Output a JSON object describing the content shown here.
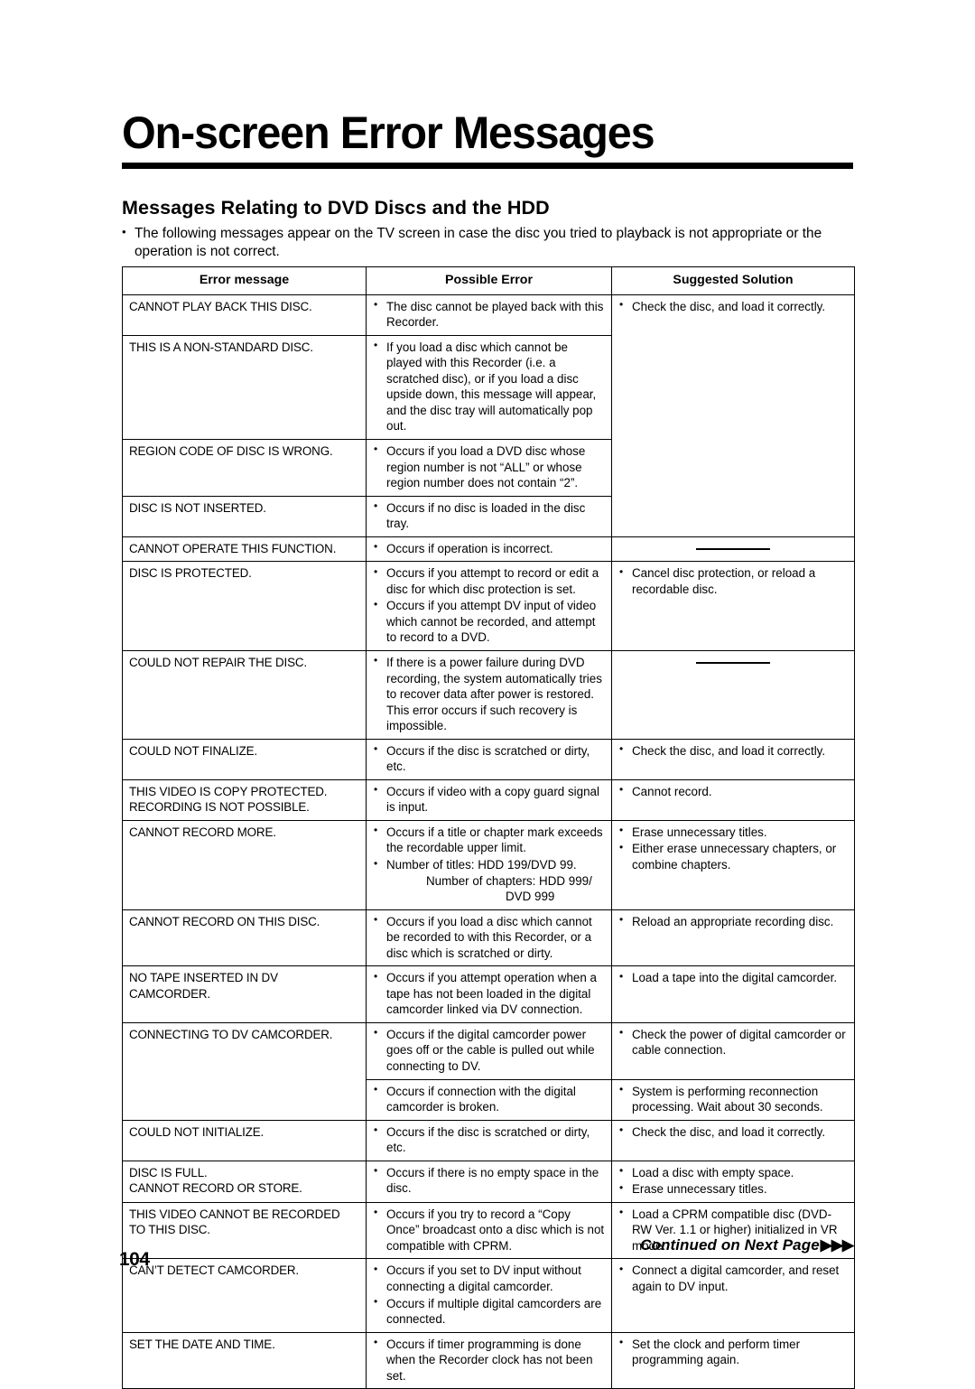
{
  "document": {
    "title": "On-screen Error Messages",
    "section_heading": "Messages Relating to DVD Discs and the HDD",
    "intro": "The following messages appear on the TV screen in case the disc you tried to playback is not appropriate or the operation is not correct.",
    "page_number": "104",
    "continued_label": "Continued on Next Page",
    "continued_arrows": "▶▶▶"
  },
  "table": {
    "headers": {
      "error_message": "Error message",
      "possible_error": "Possible Error",
      "suggested_solution": "Suggested Solution"
    },
    "rows": {
      "r1": {
        "message": "CANNOT PLAY BACK THIS DISC.",
        "error_1": "The disc cannot be played back with this Recorder.",
        "solution_1": "Check the disc, and load it correctly."
      },
      "r2": {
        "message": "THIS IS A NON-STANDARD DISC.",
        "error_1": "If you load a disc which cannot be played with this Recorder (i.e. a scratched disc), or if you load a disc upside down, this message will appear, and the disc tray will automatically pop out."
      },
      "r3": {
        "message": "REGION CODE OF DISC IS WRONG.",
        "error_1": "Occurs if you load a DVD disc whose region number is not “ALL” or whose region number does not contain “2”."
      },
      "r4": {
        "message": "DISC IS NOT INSERTED.",
        "error_1": "Occurs if no disc is loaded in the disc tray."
      },
      "r5": {
        "message": "CANNOT OPERATE THIS FUNCTION.",
        "error_1": "Occurs if operation is incorrect.",
        "solution_1": "—"
      },
      "r6": {
        "message": "DISC IS PROTECTED.",
        "error_1": "Occurs if you attempt to record or edit a disc for which disc protection is set.",
        "error_2": "Occurs if you attempt DV input of video which cannot be recorded, and attempt to record to a DVD.",
        "solution_1": "Cancel disc protection, or reload a recordable disc."
      },
      "r7": {
        "message": "COULD NOT REPAIR THE DISC.",
        "error_1": "If there is a power failure during DVD recording, the system automatically tries to recover data after power is restored. This error occurs if such recovery is impossible.",
        "solution_1": "—"
      },
      "r8": {
        "message": "COULD NOT FINALIZE.",
        "error_1": "Occurs if the disc is scratched or dirty, etc.",
        "solution_1": "Check the disc, and load it correctly."
      },
      "r9": {
        "message_line1": "THIS VIDEO IS COPY PROTECTED.",
        "message_line2": "RECORDING IS NOT POSSIBLE.",
        "error_1": "Occurs if video with a copy guard signal is input.",
        "solution_1": "Cannot record."
      },
      "r10": {
        "message": "CANNOT RECORD MORE.",
        "error_1": "Occurs if a title or chapter mark exceeds the recordable upper limit.",
        "error_2": "Number of titles: HDD 199/DVD 99.",
        "error_2_cont": "Number of chapters:  HDD 999/",
        "error_2_cont2": "DVD 999",
        "solution_1": "Erase unnecessary titles.",
        "solution_2": "Either erase unnecessary chapters, or combine chapters."
      },
      "r11": {
        "message": "CANNOT RECORD ON THIS DISC.",
        "error_1": "Occurs if you load a disc which cannot be recorded to with this Recorder, or a disc which is scratched or dirty.",
        "solution_1": "Reload an appropriate recording disc."
      },
      "r12": {
        "message_line1": "NO TAPE INSERTED IN DV",
        "message_line2": "CAMCORDER.",
        "error_1": "Occurs if you attempt operation when a tape has not been loaded in the digital camcorder linked via DV connection.",
        "solution_1": "Load a tape into the digital camcorder."
      },
      "r13": {
        "message": "CONNECTING TO DV CAMCORDER.",
        "error_1": "Occurs if the digital camcorder power goes off or the cable is pulled out while connecting to DV.",
        "solution_1": "Check the power of digital camcorder or cable connection.",
        "error_2": "Occurs if connection with the digital camcorder is broken.",
        "solution_2": "System is performing reconnection processing. Wait about 30 seconds."
      },
      "r14": {
        "message": "COULD NOT INITIALIZE.",
        "error_1": "Occurs if the disc is scratched or dirty, etc.",
        "solution_1": "Check the disc, and load it correctly."
      },
      "r15": {
        "message_line1": "DISC IS FULL.",
        "message_line2": "CANNOT RECORD OR STORE.",
        "error_1": "Occurs if there is no empty space in the disc.",
        "solution_1": "Load a disc with empty space.",
        "solution_2": "Erase unnecessary titles."
      },
      "r16": {
        "message_line1": "THIS VIDEO CANNOT BE RECORDED",
        "message_line2": "TO THIS DISC.",
        "error_1": "Occurs if you try to record a “Copy Once” broadcast onto a disc which is not compatible with CPRM.",
        "solution_1": "Load a CPRM compatible disc (DVD-RW Ver. 1.1 or higher) initialized in VR mode."
      },
      "r17": {
        "message": "CAN’T DETECT CAMCORDER.",
        "error_1": "Occurs if you set to DV input without connecting a digital camcorder.",
        "error_2": "Occurs if multiple digital camcorders are connected.",
        "solution_1": "Connect a digital camcorder, and reset again to DV input."
      },
      "r18": {
        "message": "SET THE DATE AND TIME.",
        "error_1": "Occurs if timer programming is done when the Recorder clock has not been set.",
        "solution_1": "Set the clock and perform timer programming again."
      }
    }
  }
}
